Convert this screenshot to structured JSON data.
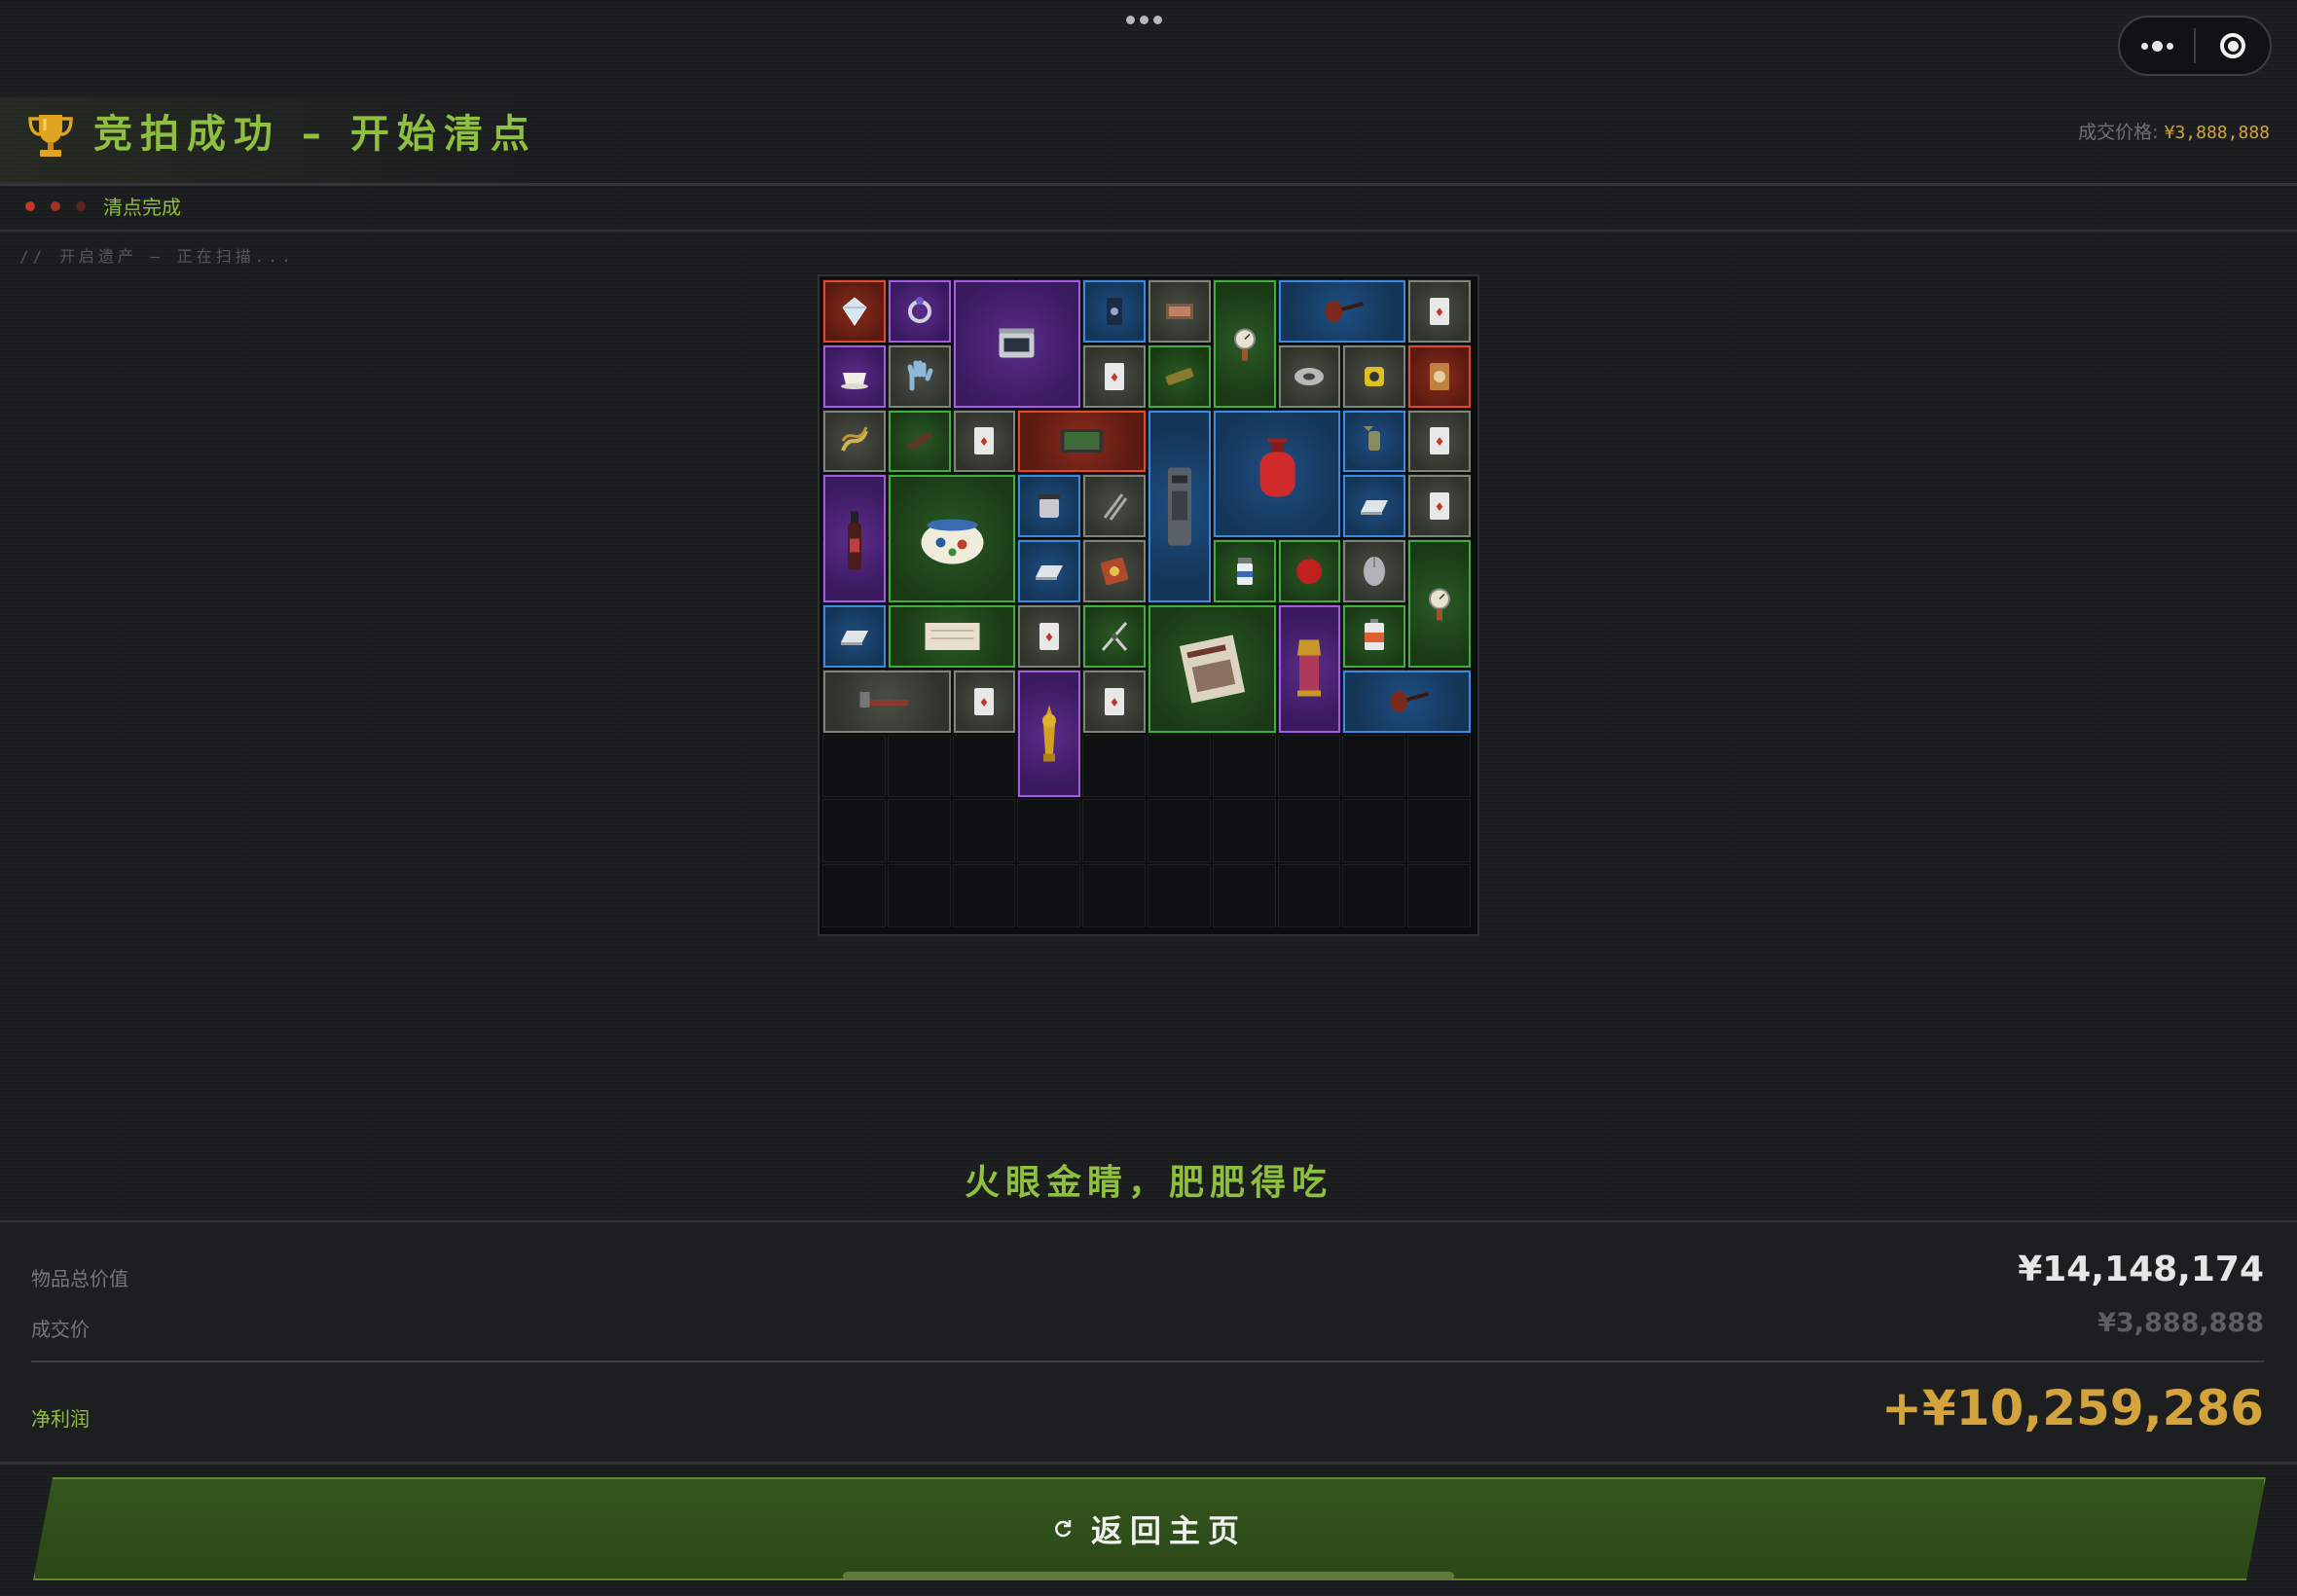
{
  "header": {
    "title": "竞拍成功 – 开始清点",
    "price_label": "成交价格:",
    "price_value": "¥3,888,888"
  },
  "status": {
    "text": "清点完成",
    "scan_text": "// 开启遗产 – 正在扫描..."
  },
  "slogan": "火眼金睛，肥肥得吃",
  "summary": {
    "total_label": "物品总价值",
    "total_value": "¥14,148,174",
    "deal_label": "成交价",
    "deal_value": "¥3,888,888",
    "profit_label": "净利润",
    "profit_value": "+¥10,259,286"
  },
  "button": {
    "label": "返回主页",
    "icon": "refresh-icon"
  },
  "colors": {
    "accent_green": "#8fbf3e",
    "gold": "#d4a33b",
    "quality_red": "#e04a2a",
    "quality_purple": "#a35ce0",
    "quality_blue": "#3b8ae0",
    "quality_green": "#3fae3a",
    "quality_gray": "#7d8478"
  },
  "grid": {
    "columns": 10,
    "rows": 10,
    "items": [
      {
        "name": "diamond",
        "q": "red",
        "c": 0,
        "r": 0,
        "w": 1,
        "h": 1
      },
      {
        "name": "ring",
        "q": "purple",
        "c": 1,
        "r": 0,
        "w": 1,
        "h": 1
      },
      {
        "name": "incubator",
        "q": "purple",
        "c": 2,
        "r": 0,
        "w": 2,
        "h": 2
      },
      {
        "name": "coffee-bag",
        "q": "blue",
        "c": 4,
        "r": 0,
        "w": 1,
        "h": 1
      },
      {
        "name": "matchbox",
        "q": "gray",
        "c": 5,
        "r": 0,
        "w": 1,
        "h": 1
      },
      {
        "name": "pressure-gauge",
        "q": "green",
        "c": 6,
        "r": 0,
        "w": 1,
        "h": 2
      },
      {
        "name": "pipe",
        "q": "blue",
        "c": 7,
        "r": 0,
        "w": 2,
        "h": 1
      },
      {
        "name": "playing-card",
        "q": "gray",
        "c": 9,
        "r": 0,
        "w": 1,
        "h": 1
      },
      {
        "name": "teacup",
        "q": "purple",
        "c": 0,
        "r": 1,
        "w": 1,
        "h": 1
      },
      {
        "name": "glove",
        "q": "gray",
        "c": 1,
        "r": 1,
        "w": 1,
        "h": 1
      },
      {
        "name": "playing-card",
        "q": "gray",
        "c": 4,
        "r": 1,
        "w": 1,
        "h": 1
      },
      {
        "name": "candy-bar",
        "q": "green",
        "c": 5,
        "r": 1,
        "w": 1,
        "h": 1
      },
      {
        "name": "tape-roll",
        "q": "gray",
        "c": 7,
        "r": 1,
        "w": 1,
        "h": 1
      },
      {
        "name": "tape-measure",
        "q": "gray",
        "c": 8,
        "r": 1,
        "w": 1,
        "h": 1
      },
      {
        "name": "snack-pack",
        "q": "red",
        "c": 9,
        "r": 1,
        "w": 1,
        "h": 1
      },
      {
        "name": "rope",
        "q": "gray",
        "c": 0,
        "r": 2,
        "w": 1,
        "h": 1
      },
      {
        "name": "cigar",
        "q": "green",
        "c": 1,
        "r": 2,
        "w": 1,
        "h": 1
      },
      {
        "name": "playing-card",
        "q": "gray",
        "c": 2,
        "r": 2,
        "w": 1,
        "h": 1
      },
      {
        "name": "tablet",
        "q": "red",
        "c": 3,
        "r": 2,
        "w": 2,
        "h": 1
      },
      {
        "name": "server-tower",
        "q": "blue",
        "c": 5,
        "r": 2,
        "w": 1,
        "h": 3
      },
      {
        "name": "gas-cylinder",
        "q": "blue",
        "c": 6,
        "r": 2,
        "w": 2,
        "h": 2
      },
      {
        "name": "candy",
        "q": "blue",
        "c": 8,
        "r": 2,
        "w": 1,
        "h": 1
      },
      {
        "name": "playing-card",
        "q": "gray",
        "c": 9,
        "r": 2,
        "w": 1,
        "h": 1
      },
      {
        "name": "spray-bottle",
        "q": "purple",
        "c": 0,
        "r": 3,
        "w": 1,
        "h": 2
      },
      {
        "name": "ceramic-pot",
        "q": "green",
        "c": 1,
        "r": 3,
        "w": 2,
        "h": 2
      },
      {
        "name": "jar",
        "q": "blue",
        "c": 3,
        "r": 3,
        "w": 1,
        "h": 1
      },
      {
        "name": "tongs",
        "q": "gray",
        "c": 4,
        "r": 3,
        "w": 1,
        "h": 1
      },
      {
        "name": "silver-bar",
        "q": "blue",
        "c": 8,
        "r": 3,
        "w": 1,
        "h": 1
      },
      {
        "name": "playing-card",
        "q": "gray",
        "c": 9,
        "r": 3,
        "w": 1,
        "h": 1
      },
      {
        "name": "silver-bar",
        "q": "blue",
        "c": 3,
        "r": 4,
        "w": 1,
        "h": 1
      },
      {
        "name": "chip-bag",
        "q": "gray",
        "c": 4,
        "r": 4,
        "w": 1,
        "h": 1
      },
      {
        "name": "pill-bottle",
        "q": "green",
        "c": 6,
        "r": 4,
        "w": 1,
        "h": 1
      },
      {
        "name": "apple",
        "q": "green",
        "c": 7,
        "r": 4,
        "w": 1,
        "h": 1
      },
      {
        "name": "mouse",
        "q": "gray",
        "c": 8,
        "r": 4,
        "w": 1,
        "h": 1
      },
      {
        "name": "pressure-gauge",
        "q": "green",
        "c": 9,
        "r": 4,
        "w": 1,
        "h": 2
      },
      {
        "name": "silver-bar",
        "q": "blue",
        "c": 0,
        "r": 5,
        "w": 1,
        "h": 1
      },
      {
        "name": "paper-scroll",
        "q": "green",
        "c": 1,
        "r": 5,
        "w": 2,
        "h": 1
      },
      {
        "name": "playing-card",
        "q": "gray",
        "c": 3,
        "r": 5,
        "w": 1,
        "h": 1
      },
      {
        "name": "pliers",
        "q": "green",
        "c": 4,
        "r": 5,
        "w": 1,
        "h": 1
      },
      {
        "name": "newspaper",
        "q": "green",
        "c": 5,
        "r": 5,
        "w": 2,
        "h": 2
      },
      {
        "name": "lantern",
        "q": "purple",
        "c": 7,
        "r": 5,
        "w": 1,
        "h": 2
      },
      {
        "name": "battery",
        "q": "green",
        "c": 8,
        "r": 5,
        "w": 1,
        "h": 1
      },
      {
        "name": "hammer",
        "q": "gray",
        "c": 0,
        "r": 6,
        "w": 2,
        "h": 1
      },
      {
        "name": "playing-card",
        "q": "gray",
        "c": 2,
        "r": 6,
        "w": 1,
        "h": 1
      },
      {
        "name": "golden-statue",
        "q": "purple",
        "c": 3,
        "r": 6,
        "w": 1,
        "h": 2
      },
      {
        "name": "playing-card",
        "q": "gray",
        "c": 4,
        "r": 6,
        "w": 1,
        "h": 1
      },
      {
        "name": "pipe",
        "q": "blue",
        "c": 8,
        "r": 6,
        "w": 2,
        "h": 1
      }
    ]
  }
}
